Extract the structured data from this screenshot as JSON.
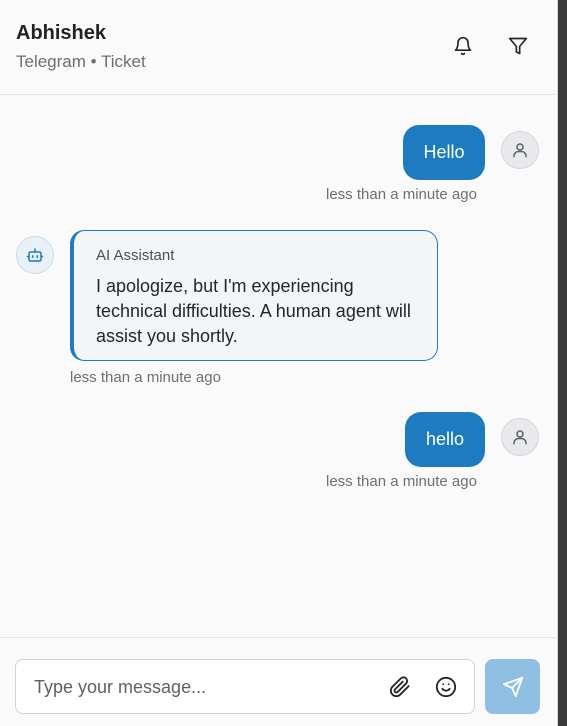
{
  "header": {
    "name": "Abhishek",
    "subtitle": "Telegram • Ticket"
  },
  "messages": [
    {
      "sender": "user",
      "text": "Hello",
      "time": "less than a minute ago"
    },
    {
      "sender": "bot",
      "sender_label": "AI Assistant",
      "text": "I apologize, but I'm experiencing technical difficulties. A human agent will assist you shortly.",
      "time": "less than a minute ago"
    },
    {
      "sender": "user",
      "text": "hello",
      "time": "less than a minute ago"
    }
  ],
  "composer": {
    "placeholder": "Type your message..."
  },
  "icons": {
    "notifications": "bell-icon",
    "filter": "filter-icon",
    "user_avatar": "user-icon",
    "bot_avatar": "robot-icon",
    "attach": "paperclip-icon",
    "emoji": "smiley-icon",
    "send": "send-icon"
  },
  "colors": {
    "accent": "#1d7bbf",
    "send_disabled": "#8fbfe3"
  }
}
